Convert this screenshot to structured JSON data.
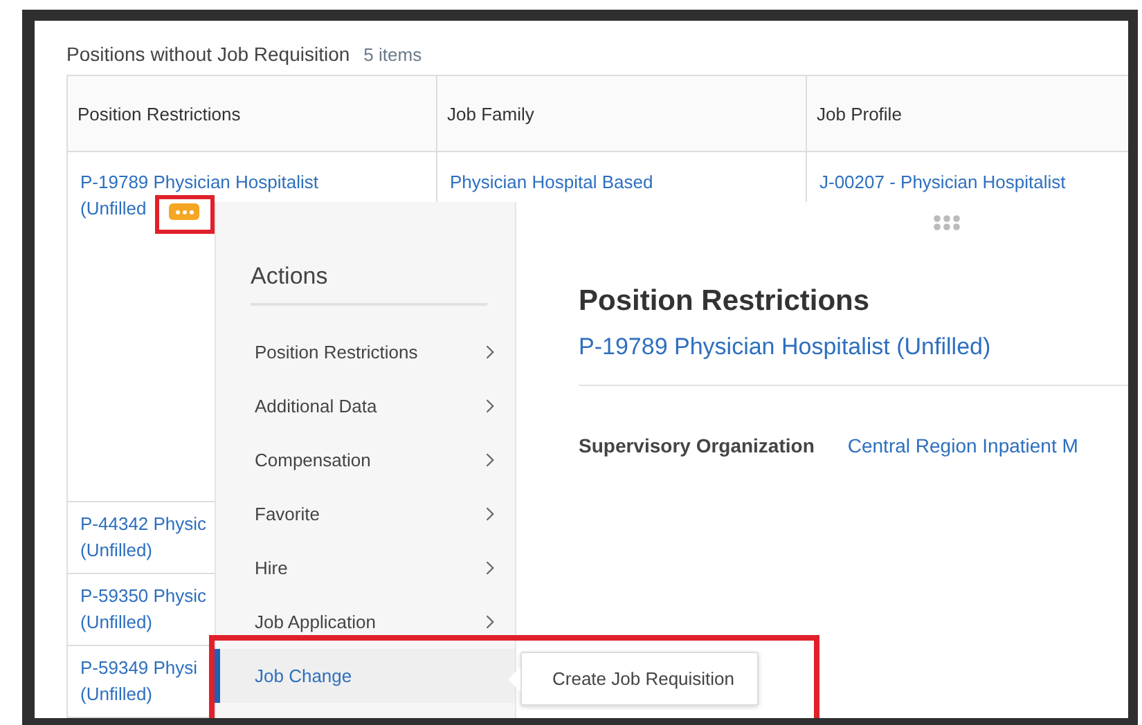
{
  "section": {
    "title": "Positions without Job Requisition",
    "count": "5 items"
  },
  "table": {
    "columns": [
      "Position Restrictions",
      "Job Family",
      "Job Profile"
    ],
    "rows": [
      {
        "position": [
          "P-19789 Physician Hospitalist",
          "(Unfilled"
        ],
        "job_family": "Physician Hospital Based",
        "job_profile": "J-00207 - Physician Hospitalist",
        "has_actions": true
      },
      {
        "position": [
          "P-44342 Physic",
          "(Unfilled)"
        ]
      },
      {
        "position": [
          "P-59350 Physic",
          "(Unfilled)"
        ]
      },
      {
        "position": [
          "P-59349 Physi",
          "(Unfilled)"
        ]
      }
    ]
  },
  "actions_menu": {
    "title": "Actions",
    "items": [
      {
        "label": "Position Restrictions",
        "has_submenu": true,
        "selected": false
      },
      {
        "label": "Additional Data",
        "has_submenu": true,
        "selected": false
      },
      {
        "label": "Compensation",
        "has_submenu": true,
        "selected": false
      },
      {
        "label": "Favorite",
        "has_submenu": true,
        "selected": false
      },
      {
        "label": "Hire",
        "has_submenu": true,
        "selected": false
      },
      {
        "label": "Job Application",
        "has_submenu": true,
        "selected": false
      },
      {
        "label": "Job Change",
        "has_submenu": false,
        "selected": true
      }
    ]
  },
  "submenu": {
    "items": [
      "Create Job Requisition"
    ]
  },
  "detail": {
    "heading": "Position Restrictions",
    "link": "P-19789 Physician Hospitalist (Unfilled)",
    "fields": [
      {
        "label": "Supervisory Organization",
        "value": "Central Region Inpatient M"
      }
    ]
  }
}
